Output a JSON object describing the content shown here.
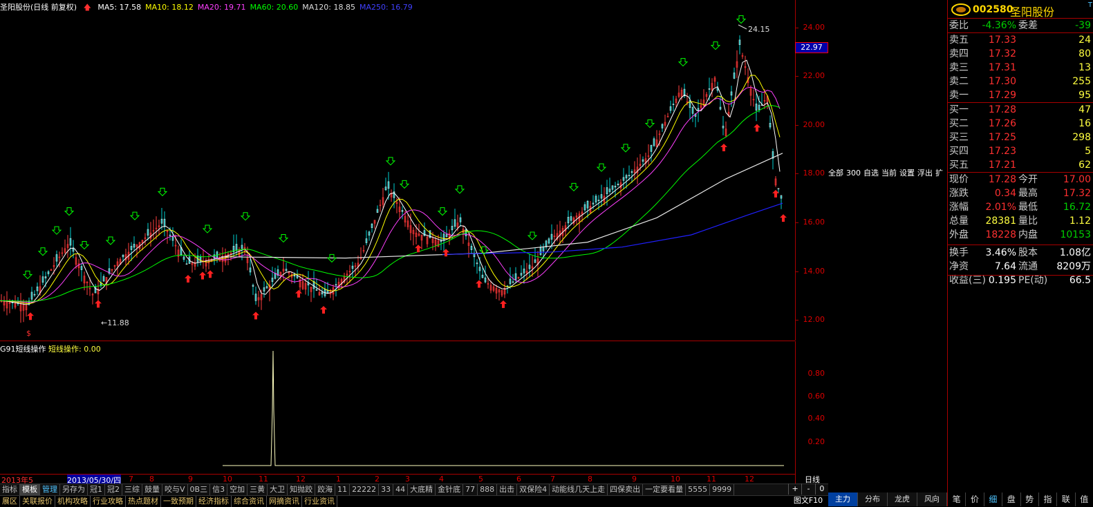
{
  "title_bar": {
    "stock_label": "圣阳股份(日线 前复权)",
    "ma": [
      {
        "label": "MA5: 17.58",
        "color": "#ffffff"
      },
      {
        "label": "MA10: 18.12",
        "color": "#ffff00"
      },
      {
        "label": "MA20: 19.71",
        "color": "#ff40ff"
      },
      {
        "label": "MA60: 20.60",
        "color": "#00ff00"
      },
      {
        "label": "MA120: 18.85",
        "color": "#dddddd"
      },
      {
        "label": "MA250: 16.79",
        "color": "#4040ff"
      }
    ]
  },
  "price_axis": [
    "24.00",
    "22.00",
    "20.00",
    "18.00",
    "16.00",
    "14.00",
    "12.00"
  ],
  "current_price_tag": "22.97",
  "annotations": {
    "high": "24.15",
    "low": "11.88"
  },
  "indicator": {
    "name": "G91短线操作",
    "value": "短线操作: 0.00",
    "axis": [
      "0.80",
      "0.60",
      "0.40",
      "0.20"
    ]
  },
  "dates": [
    "2013年5",
    "2013/05/30/四",
    "7",
    "8",
    "9",
    "10",
    "11",
    "12",
    "1",
    "2",
    "3",
    "4",
    "5",
    "6",
    "7",
    "8",
    "9",
    "10",
    "11",
    "12"
  ],
  "period": "日线",
  "pm": [
    "+",
    "-",
    "0"
  ],
  "tabs": [
    "指标",
    "模板",
    "管理",
    "另存为",
    "冠1",
    "冠2",
    "三综",
    "鼓量",
    "咬与V",
    "0B三",
    "信3",
    "空加",
    "三黄",
    "大卫",
    "知抛跤",
    "跤海",
    "11",
    "22222",
    "33",
    "44",
    "大底精",
    "金针底",
    "77",
    "888",
    "出击",
    "双保险4",
    "动能线几天上走",
    "四保卖出",
    "一定要看量",
    "5555",
    "9999"
  ],
  "bottom_links": [
    "展区",
    "关联报价",
    "机构攻略",
    "行业攻略",
    "热点题材",
    "一致预期",
    "经济指标",
    "综合资讯",
    "网摘资讯",
    "行业资讯"
  ],
  "tuwen": "图文F10",
  "mid_menu": [
    "全部",
    "300",
    "自选",
    "当前",
    "设置",
    "浮出",
    "扩"
  ],
  "mid_tabs": [
    "主力",
    "分布",
    "龙虎",
    "风向"
  ],
  "quote": {
    "code": "002580",
    "name": "圣阳股份",
    "t_label": "T",
    "weibi": {
      "label": "委比",
      "value": "-4.36%",
      "label2": "委差",
      "value2": "-39"
    },
    "sell": [
      {
        "label": "卖五",
        "price": "17.33",
        "vol": "24"
      },
      {
        "label": "卖四",
        "price": "17.32",
        "vol": "80"
      },
      {
        "label": "卖三",
        "price": "17.31",
        "vol": "13"
      },
      {
        "label": "卖二",
        "price": "17.30",
        "vol": "255"
      },
      {
        "label": "卖一",
        "price": "17.29",
        "vol": "95"
      }
    ],
    "buy": [
      {
        "label": "买一",
        "price": "17.28",
        "vol": "47"
      },
      {
        "label": "买二",
        "price": "17.26",
        "vol": "16"
      },
      {
        "label": "买三",
        "price": "17.25",
        "vol": "298"
      },
      {
        "label": "买四",
        "price": "17.23",
        "vol": "5"
      },
      {
        "label": "买五",
        "price": "17.21",
        "vol": "62"
      }
    ],
    "stats": [
      {
        "l": "现价",
        "v": "17.28",
        "l2": "今开",
        "v2": "17.00"
      },
      {
        "l": "涨跌",
        "v": "0.34",
        "l2": "最高",
        "v2": "17.32"
      },
      {
        "l": "涨幅",
        "v": "2.01%",
        "l2": "最低",
        "v2": "16.72"
      },
      {
        "l": "总量",
        "v": "28381",
        "l2": "量比",
        "v2": "1.12"
      },
      {
        "l": "外盘",
        "v": "18228",
        "l2": "内盘",
        "v2": "10153"
      }
    ],
    "fin": [
      {
        "l": "换手",
        "v": "3.46%",
        "l2": "股本",
        "v2": "1.08亿"
      },
      {
        "l": "净资",
        "v": "7.64",
        "l2": "流通",
        "v2": "8209万"
      },
      {
        "l": "收益(三)",
        "v": "0.195",
        "l2": "PE(动)",
        "v2": "66.5"
      }
    ],
    "bottom_tabs": [
      "笔",
      "价",
      "细",
      "盘",
      "势",
      "指",
      "联",
      "值"
    ]
  },
  "colors": {
    "up": "#ff3030",
    "down": "#00d000",
    "accent": "#4ec3ff",
    "border": "#aa0000"
  }
}
